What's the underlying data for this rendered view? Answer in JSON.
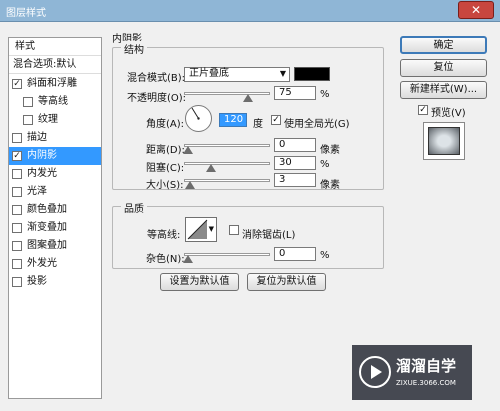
{
  "window": {
    "title": "图层样式",
    "close_label": "✕"
  },
  "sidebar": {
    "header": "样式",
    "blend_options": "混合选项:默认",
    "items": [
      {
        "label": "斜面和浮雕",
        "checked": true
      },
      {
        "label": "等高线",
        "checked": false
      },
      {
        "label": "纹理",
        "checked": false
      },
      {
        "label": "描边",
        "checked": false
      },
      {
        "label": "内阴影",
        "checked": true,
        "selected": true
      },
      {
        "label": "内发光",
        "checked": false
      },
      {
        "label": "光泽",
        "checked": false
      },
      {
        "label": "颜色叠加",
        "checked": false
      },
      {
        "label": "渐变叠加",
        "checked": false
      },
      {
        "label": "图案叠加",
        "checked": false
      },
      {
        "label": "外发光",
        "checked": false
      },
      {
        "label": "投影",
        "checked": false
      }
    ]
  },
  "panel": {
    "section_title": "内阴影",
    "structure_title": "结构",
    "blend_mode_label": "混合模式(B):",
    "blend_mode_value": "正片叠底",
    "shadow_color": "#000000",
    "opacity_label": "不透明度(O):",
    "opacity_value": "75",
    "opacity_unit": "%",
    "angle_label": "角度(A):",
    "angle_value": "120",
    "angle_unit": "度",
    "global_light_label": "使用全局光(G)",
    "global_light_checked": true,
    "distance_label": "距离(D):",
    "distance_value": "0",
    "distance_unit": "像素",
    "choke_label": "阻塞(C):",
    "choke_value": "30",
    "choke_unit": "%",
    "size_label": "大小(S):",
    "size_value": "3",
    "size_unit": "像素",
    "quality_title": "品质",
    "contour_label": "等高线:",
    "antialias_label": "消除锯齿(L)",
    "antialias_checked": false,
    "noise_label": "杂色(N):",
    "noise_value": "0",
    "noise_unit": "%",
    "make_default_label": "设置为默认值",
    "reset_default_label": "复位为默认值"
  },
  "actions": {
    "ok_label": "确定",
    "reset_label": "复位",
    "new_style_label": "新建样式(W)...",
    "preview_label": "预览(V)",
    "preview_checked": true
  },
  "watermark": {
    "brand": "溜溜自学",
    "url": "ZIXUE.3066.COM"
  }
}
